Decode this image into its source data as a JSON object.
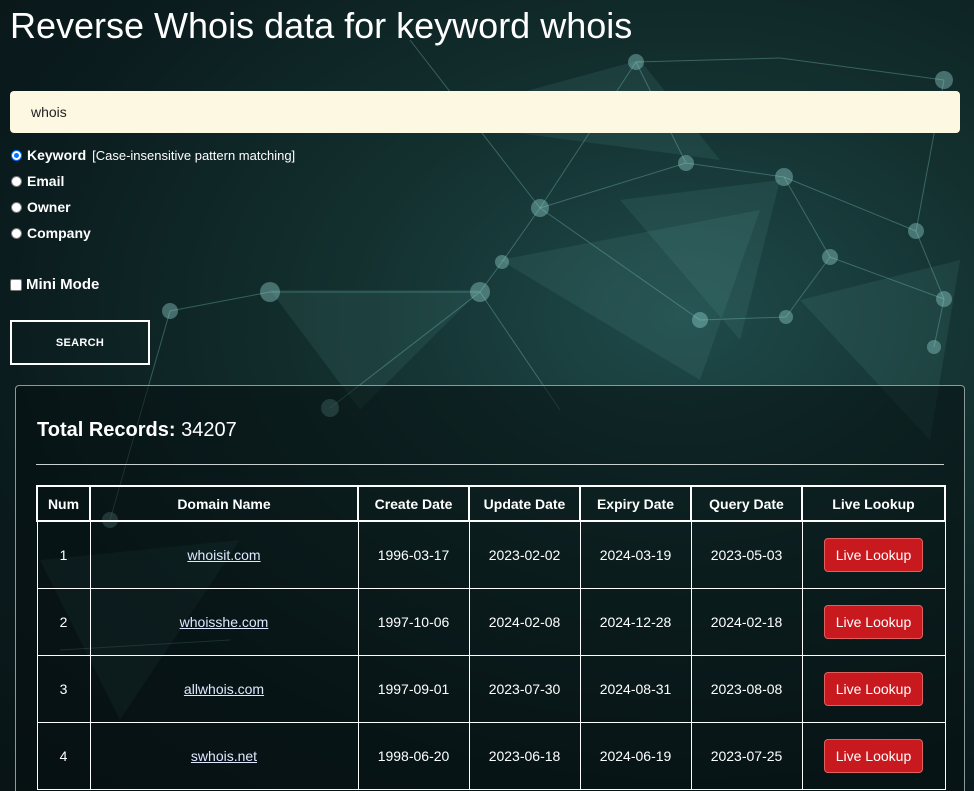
{
  "page": {
    "title": "Reverse Whois data for keyword whois"
  },
  "search": {
    "value": "whois",
    "modes": [
      {
        "label": "Keyword",
        "hint": "[Case-insensitive pattern matching]",
        "checked": true
      },
      {
        "label": "Email",
        "checked": false
      },
      {
        "label": "Owner",
        "checked": false
      },
      {
        "label": "Company",
        "checked": false
      }
    ],
    "mini_mode_label": "Mini Mode",
    "mini_mode_checked": false,
    "button_label": "SEARCH"
  },
  "results": {
    "total_label": "Total Records:",
    "total_value": "34207",
    "columns": [
      "Num",
      "Domain Name",
      "Create Date",
      "Update Date",
      "Expiry Date",
      "Query Date",
      "Live Lookup"
    ],
    "rows": [
      {
        "num": "1",
        "domain": "whoisit.com",
        "create": "1996-03-17",
        "update": "2023-02-02",
        "expiry": "2024-03-19",
        "query": "2023-05-03",
        "action": "Live Lookup"
      },
      {
        "num": "2",
        "domain": "whoisshe.com",
        "create": "1997-10-06",
        "update": "2024-02-08",
        "expiry": "2024-12-28",
        "query": "2024-02-18",
        "action": "Live Lookup"
      },
      {
        "num": "3",
        "domain": "allwhois.com",
        "create": "1997-09-01",
        "update": "2023-07-30",
        "expiry": "2024-08-31",
        "query": "2023-08-08",
        "action": "Live Lookup"
      },
      {
        "num": "4",
        "domain": "swhois.net",
        "create": "1998-06-20",
        "update": "2023-06-18",
        "expiry": "2024-06-19",
        "query": "2023-07-25",
        "action": "Live Lookup"
      }
    ]
  },
  "colors": {
    "input_background": "#fdf8e1",
    "live_lookup_button": "#c8191e",
    "background_dark": "#0b1c1e",
    "network_lines": "#5fa7a0"
  }
}
